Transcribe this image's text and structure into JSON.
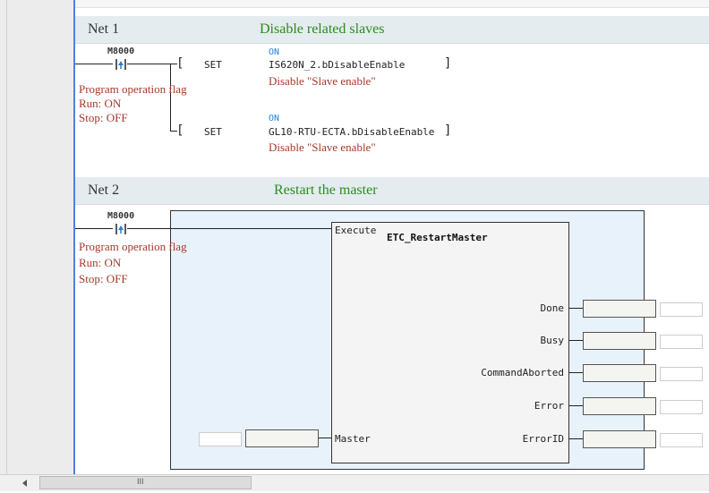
{
  "networks": [
    {
      "title": "Net 1",
      "comment": "Disable related slaves",
      "contact": {
        "tag": "M8000",
        "comment_lines": [
          "Program operation flag",
          "Run: ON",
          "Stop: OFF"
        ]
      },
      "coils": [
        {
          "instruction": "SET",
          "state": "ON",
          "operand": "IS620N_2.bDisableEnable",
          "comment": "Disable \"Slave enable\""
        },
        {
          "instruction": "SET",
          "state": "ON",
          "operand": "GL10-RTU-ECTA.bDisableEnable",
          "comment": "Disable \"Slave enable\""
        }
      ]
    },
    {
      "title": "Net 2",
      "comment": "Restart the master",
      "contact": {
        "tag": "M8000",
        "comment_lines": [
          "Program operation flag",
          "Run: ON",
          "Stop: OFF"
        ]
      },
      "function_block": {
        "name": "ETC_RestartMaster",
        "input_execute": "Execute",
        "input_master": "Master",
        "outputs": [
          "Done",
          "Busy",
          "CommandAborted",
          "Error",
          "ErrorID"
        ]
      }
    }
  ],
  "scrollbar": {
    "grip": "III"
  },
  "colors": {
    "comment_green": "#2e8b1e",
    "comment_red": "#a33a2a",
    "state_blue": "#2a7fd4",
    "accent_blue": "#4a86d0"
  }
}
